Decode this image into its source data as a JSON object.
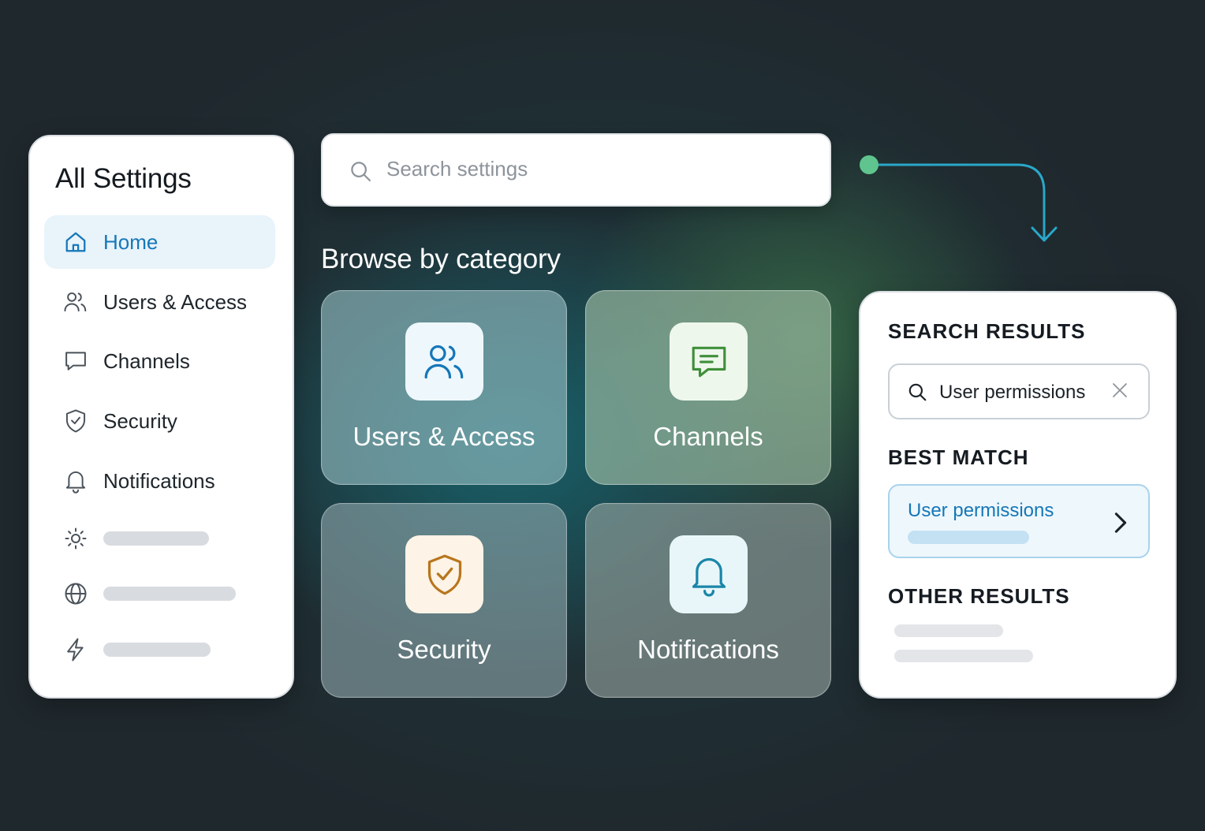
{
  "sidebar": {
    "title": "All Settings",
    "items": [
      {
        "label": "Home",
        "icon": "home-icon",
        "active": true
      },
      {
        "label": "Users & Access",
        "icon": "users-icon"
      },
      {
        "label": "Channels",
        "icon": "chat-icon"
      },
      {
        "label": "Security",
        "icon": "shield-icon"
      },
      {
        "label": "Notifications",
        "icon": "bell-icon"
      }
    ],
    "placeholder_icons": [
      "sun-icon",
      "globe-icon",
      "lightning-icon"
    ]
  },
  "search": {
    "placeholder": "Search settings",
    "icon": "search-icon"
  },
  "browse": {
    "title": "Browse by category",
    "tiles": [
      {
        "label": "Users & Access",
        "icon": "users-icon",
        "color": "#1577b8"
      },
      {
        "label": "Channels",
        "icon": "chat-icon",
        "color": "#3f8f3a"
      },
      {
        "label": "Security",
        "icon": "shield-check-icon",
        "color": "#b8761d"
      },
      {
        "label": "Notifications",
        "icon": "bell-icon",
        "color": "#1a86a8"
      }
    ]
  },
  "results": {
    "heading": "SEARCH RESULTS",
    "query": "User permissions",
    "best_match_heading": "BEST MATCH",
    "best_match_label": "User permissions",
    "other_results_heading": "OTHER RESULTS"
  },
  "colors": {
    "accent": "#1577b8",
    "connector_dot": "#5fc48e",
    "connector_line": "#2aa7c9"
  }
}
